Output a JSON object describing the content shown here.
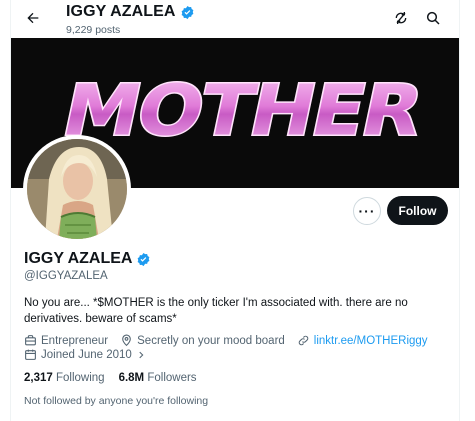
{
  "header": {
    "name": "IGGY AZALEA",
    "posts": "9,229 posts"
  },
  "banner": {
    "text": "MOTHER"
  },
  "actions": {
    "more": "···",
    "follow": "Follow"
  },
  "profile": {
    "display_name": "IGGY AZALEA",
    "handle": "@IGGYAZALEA",
    "bio": "No you are... *$MOTHER is the only ticker I'm associated with. there are no derivatives. beware of scams*",
    "profession": "Entrepreneur",
    "location": "Secretly on your mood board",
    "link": "linktr.ee/MOTHERiggy",
    "joined": "Joined June 2010",
    "verified_color": "#1d9bf0"
  },
  "stats": {
    "following_count": "2,317",
    "following_label": "Following",
    "followers_count": "6.8M",
    "followers_label": "Followers"
  },
  "footer": {
    "not_followed": "Not followed by anyone you're following"
  },
  "icons": [
    "back-arrow-icon",
    "verified-badge-icon",
    "rotate-icon",
    "search-icon",
    "briefcase-icon",
    "location-pin-icon",
    "link-icon",
    "calendar-icon",
    "chevron-right-icon"
  ]
}
